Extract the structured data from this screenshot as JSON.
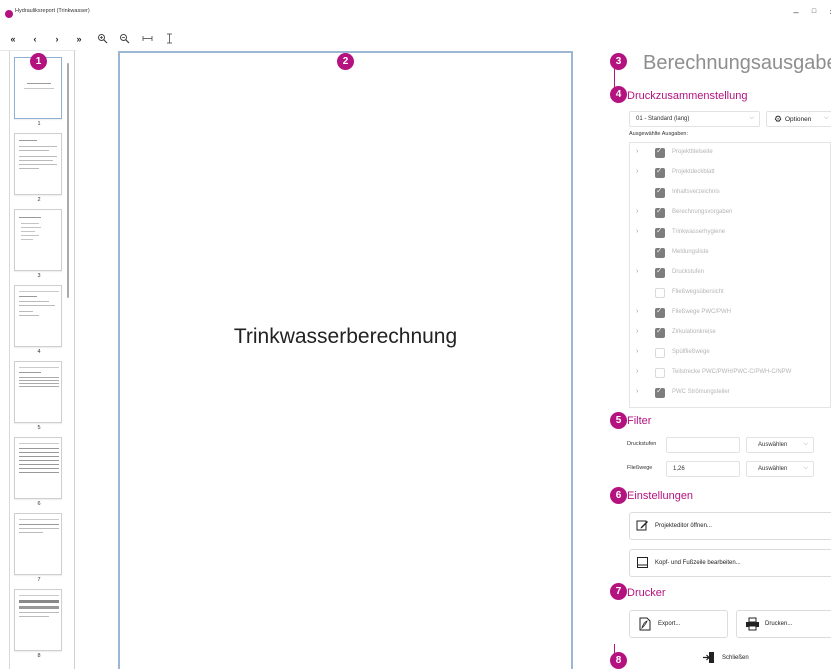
{
  "window": {
    "title": "Hydrauliksreport (Trinkwasser)",
    "minimize": "–",
    "maximize": "□",
    "close": "×"
  },
  "toolbar": {
    "first": "«",
    "prev": "‹",
    "next": "›",
    "last": "»",
    "zoom_in": "🔍",
    "zoom_out": "🔍",
    "fit_width": "↔",
    "fit_height": "↕"
  },
  "thumbnails": {
    "badge": "1",
    "pages": [
      "1",
      "2",
      "3",
      "4",
      "5",
      "6",
      "7",
      "8"
    ]
  },
  "preview": {
    "badge": "2",
    "document_title": "Trinkwasserberechnung"
  },
  "right_panel": {
    "badge": "3",
    "title": "Berechnungsausgabe",
    "print_compilation": {
      "badge": "4",
      "heading": "Druckzusammenstellung",
      "template_value": "01 - Standard (lang)",
      "options_label": "Optionen",
      "selected_outputs_label": "Ausgewählte Ausgaben:",
      "items": [
        {
          "label": "Projekttitelseite",
          "expandable": true,
          "checked": true
        },
        {
          "label": "Projektdeckblatt",
          "expandable": true,
          "checked": true
        },
        {
          "label": "Inhaltsverzeichnis",
          "expandable": false,
          "checked": true
        },
        {
          "label": "Berechnungsvorgaben",
          "expandable": true,
          "checked": true
        },
        {
          "label": "Trinkwasserhygiene",
          "expandable": true,
          "checked": true
        },
        {
          "label": "Meldungsliste",
          "expandable": false,
          "checked": true
        },
        {
          "label": "Druckstufen",
          "expandable": true,
          "checked": true
        },
        {
          "label": "Fließwegsübersicht",
          "expandable": false,
          "checked": false
        },
        {
          "label": "Fließwege PWC/PWH",
          "expandable": true,
          "checked": true
        },
        {
          "label": "Zirkulationkreise",
          "expandable": true,
          "checked": true
        },
        {
          "label": "Spülfließwege",
          "expandable": true,
          "checked": false
        },
        {
          "label": "Teilstrecke PWC/PWH/PWC-C/PWH-C/NPW",
          "expandable": true,
          "checked": false
        },
        {
          "label": "PWC Strömungsteiler",
          "expandable": true,
          "checked": true
        }
      ]
    },
    "filter": {
      "badge": "5",
      "heading": "Filter",
      "rows": [
        {
          "label": "Druckstufen",
          "value": "",
          "select": "Auswählen"
        },
        {
          "label": "Fließwege",
          "value": "1,26",
          "select": "Auswählen"
        }
      ]
    },
    "settings": {
      "badge": "6",
      "heading": "Einstellungen",
      "open_editor": "Projekteditor öffnen...",
      "edit_header_footer": "Kopf- und Fußzeile bearbeiten..."
    },
    "printer": {
      "badge": "7",
      "heading": "Drucker",
      "export": "Export...",
      "print": "Drucken..."
    },
    "footer": {
      "badge": "8",
      "close": "Schließen"
    }
  },
  "colors": {
    "accent": "#b4127f",
    "page_border": "#9bb7d3"
  }
}
